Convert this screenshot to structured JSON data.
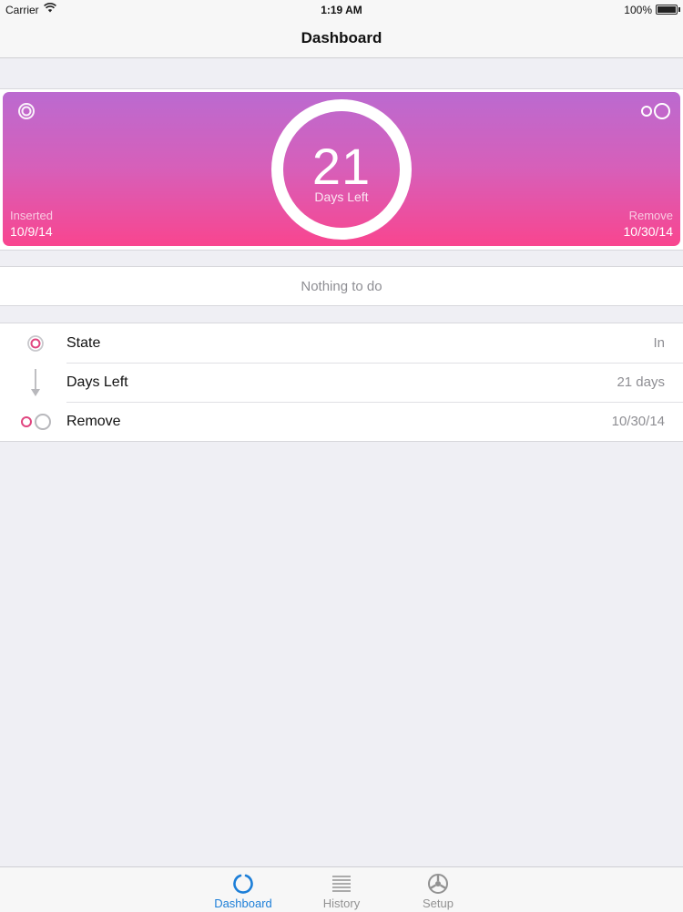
{
  "status_bar": {
    "carrier": "Carrier",
    "time": "1:19 AM",
    "battery": "100%"
  },
  "nav": {
    "title": "Dashboard"
  },
  "hero": {
    "days_number": "21",
    "days_label": "Days Left",
    "inserted_label": "Inserted",
    "inserted_date": "10/9/14",
    "remove_label": "Remove",
    "remove_date": "10/30/14",
    "gradient_top": "#bb6ad0",
    "gradient_bottom": "#f9458f"
  },
  "todo": {
    "text": "Nothing to do"
  },
  "info": {
    "rows": [
      {
        "icon": "state-ring-icon",
        "label": "State",
        "value": "In"
      },
      {
        "icon": "arrow-down-icon",
        "label": "Days Left",
        "value": "21 days"
      },
      {
        "icon": "remove-circles-icon",
        "label": "Remove",
        "value": "10/30/14"
      }
    ]
  },
  "tabs": [
    {
      "icon": "dashboard-icon",
      "label": "Dashboard",
      "active": true
    },
    {
      "icon": "history-list-icon",
      "label": "History",
      "active": false
    },
    {
      "icon": "setup-icon",
      "label": "Setup",
      "active": false
    }
  ],
  "colors": {
    "accent": "#1d7fd8",
    "pink": "#e0457f"
  }
}
